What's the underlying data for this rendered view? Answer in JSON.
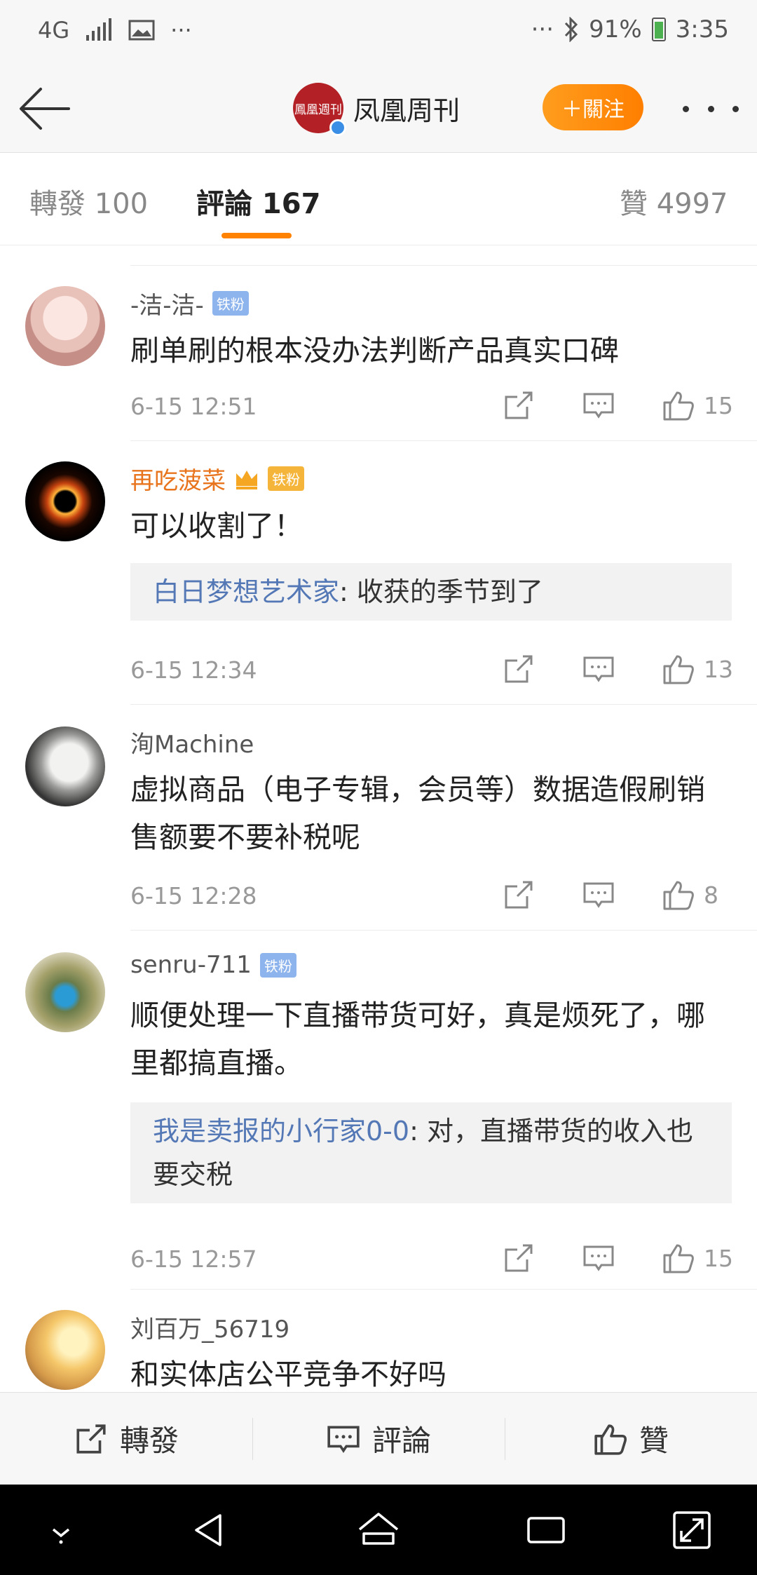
{
  "status_bar": {
    "network": "4G",
    "battery": "91%",
    "time": "3:35",
    "icons": [
      "signal-icon",
      "image-icon",
      "more-dots-icon",
      "bluetooth-icon",
      "battery-icon"
    ]
  },
  "navbar": {
    "account_name": "凤凰周刊",
    "avatar_text": "鳳凰週刊",
    "follow_label": "＋關注"
  },
  "tabs": [
    {
      "label": "轉發 100"
    },
    {
      "label": "評論 167"
    },
    {
      "label": "贊 4997"
    }
  ],
  "comments": [
    {
      "user": "-洁-洁-",
      "badge": "铁粉",
      "text": "刷单刷的根本没办法判断产品真实口碑",
      "time": "6-15 12:51",
      "likes": "15"
    },
    {
      "user": "再吃菠菜",
      "badge": "铁粉",
      "text": "可以收割了！",
      "reply_user": "白日梦想艺术家",
      "reply_text": ": 收获的季节到了",
      "time": "6-15 12:34",
      "likes": "13"
    },
    {
      "user": "洵Machine",
      "text": "虚拟商品（电子专辑，会员等）数据造假刷销售额要不要补税呢",
      "time": "6-15 12:28",
      "likes": "8"
    },
    {
      "user": "senru-711",
      "badge": "铁粉",
      "text": "顺便处理一下直播带货可好，真是烦死了，哪里都搞直播。",
      "reply_user": "我是卖报的小行家0-0",
      "reply_text": ": 对，直播带货的收入也要交税",
      "time": "6-15 12:57",
      "likes": "15"
    },
    {
      "user": "刘百万_56719",
      "text": "和实体店公平竞争不好吗"
    }
  ],
  "bottom_bar": {
    "repost": "轉發",
    "comment": "評論",
    "like": "贊"
  },
  "colors": {
    "accent": "#ff8200",
    "link": "#5378b5",
    "vip_name": "#e8741d"
  }
}
